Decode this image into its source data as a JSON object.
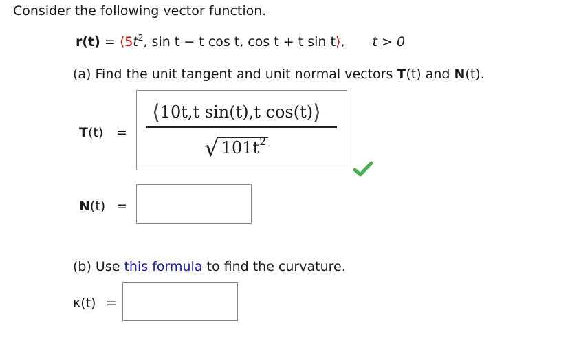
{
  "intro": "Consider the following vector function.",
  "vector_function": {
    "lhs": "r(t)",
    "coef": "5",
    "c1_rest": "t",
    "c1_exp": "2",
    "c2": "sin t − t cos t",
    "c3": "cos t + t sin t",
    "condition": "t > 0"
  },
  "part_a": {
    "label": "(a) Find the unit tangent and unit normal vectors ",
    "T": "T",
    "N": "N",
    "of_t": "(t)",
    "and": " and ",
    "end": "."
  },
  "T_answer": {
    "label_bold": "T",
    "label_rest": "(t)",
    "equals": "=",
    "numerator": "10t,t sin(t),t cos(t)",
    "denominator_base": "101t",
    "denominator_exp": "2",
    "status": "correct",
    "status_color": "#4caf50"
  },
  "N_answer": {
    "label_bold": "N",
    "label_rest": "(t)",
    "equals": "=",
    "value": ""
  },
  "part_b": {
    "prefix": "(b) Use ",
    "link": "this formula",
    "suffix": " to find the curvature."
  },
  "kappa_answer": {
    "label": "κ(t)",
    "equals": "=",
    "value": ""
  },
  "colors": {
    "text": "#1a1a1a",
    "highlight_red": "#cc0000",
    "link_blue": "#1a1aa8",
    "box_border": "#8a8a8a"
  }
}
